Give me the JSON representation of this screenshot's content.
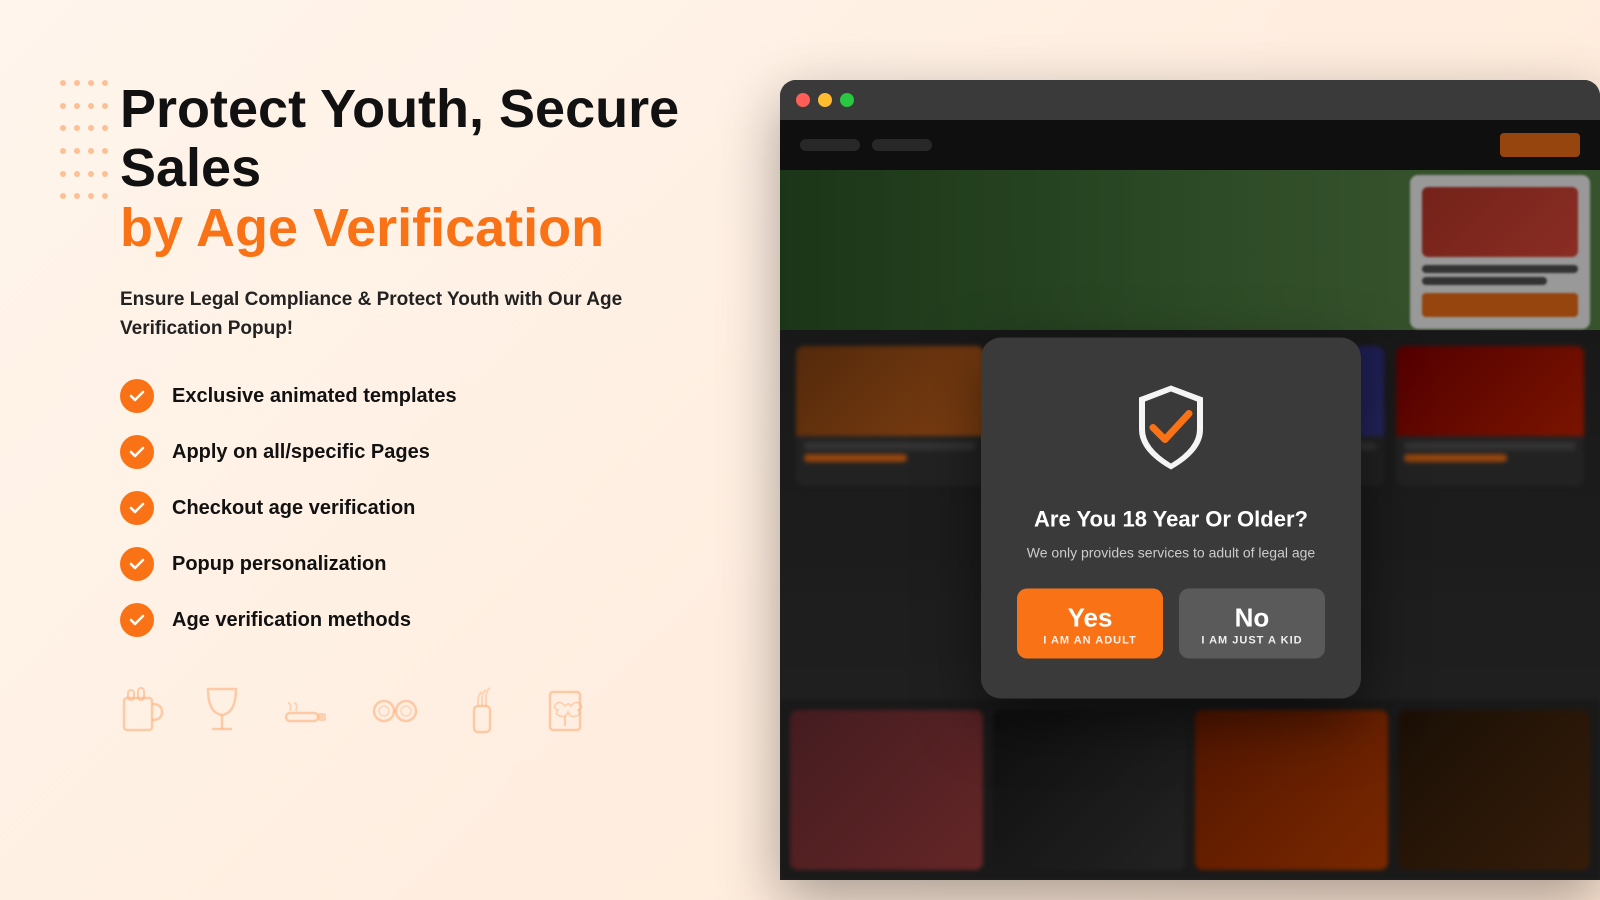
{
  "page": {
    "background": "#fff5ec"
  },
  "left": {
    "headline_black": "Protect Youth, Secure Sales",
    "headline_orange": "by Age Verification",
    "subheading": "Ensure Legal Compliance & Protect Youth with Our Age Verification Popup!",
    "features": [
      "Exclusive animated templates",
      "Apply on all/specific Pages",
      "Checkout age verification",
      "Popup personalization",
      "Age verification methods"
    ],
    "icons": [
      "🍺",
      "🍷",
      "🚬",
      "⚙️",
      "💨",
      "📋"
    ]
  },
  "popup": {
    "title": "Are You 18 Year Or Older?",
    "subtitle": "We only provides services to adult of legal age",
    "yes_main": "Yes",
    "yes_sub": "I AM AN ADULT",
    "no_main": "No",
    "no_sub": "I AM JUST A KID"
  },
  "browser": {
    "traffic_lights": [
      "red",
      "yellow",
      "green"
    ]
  }
}
